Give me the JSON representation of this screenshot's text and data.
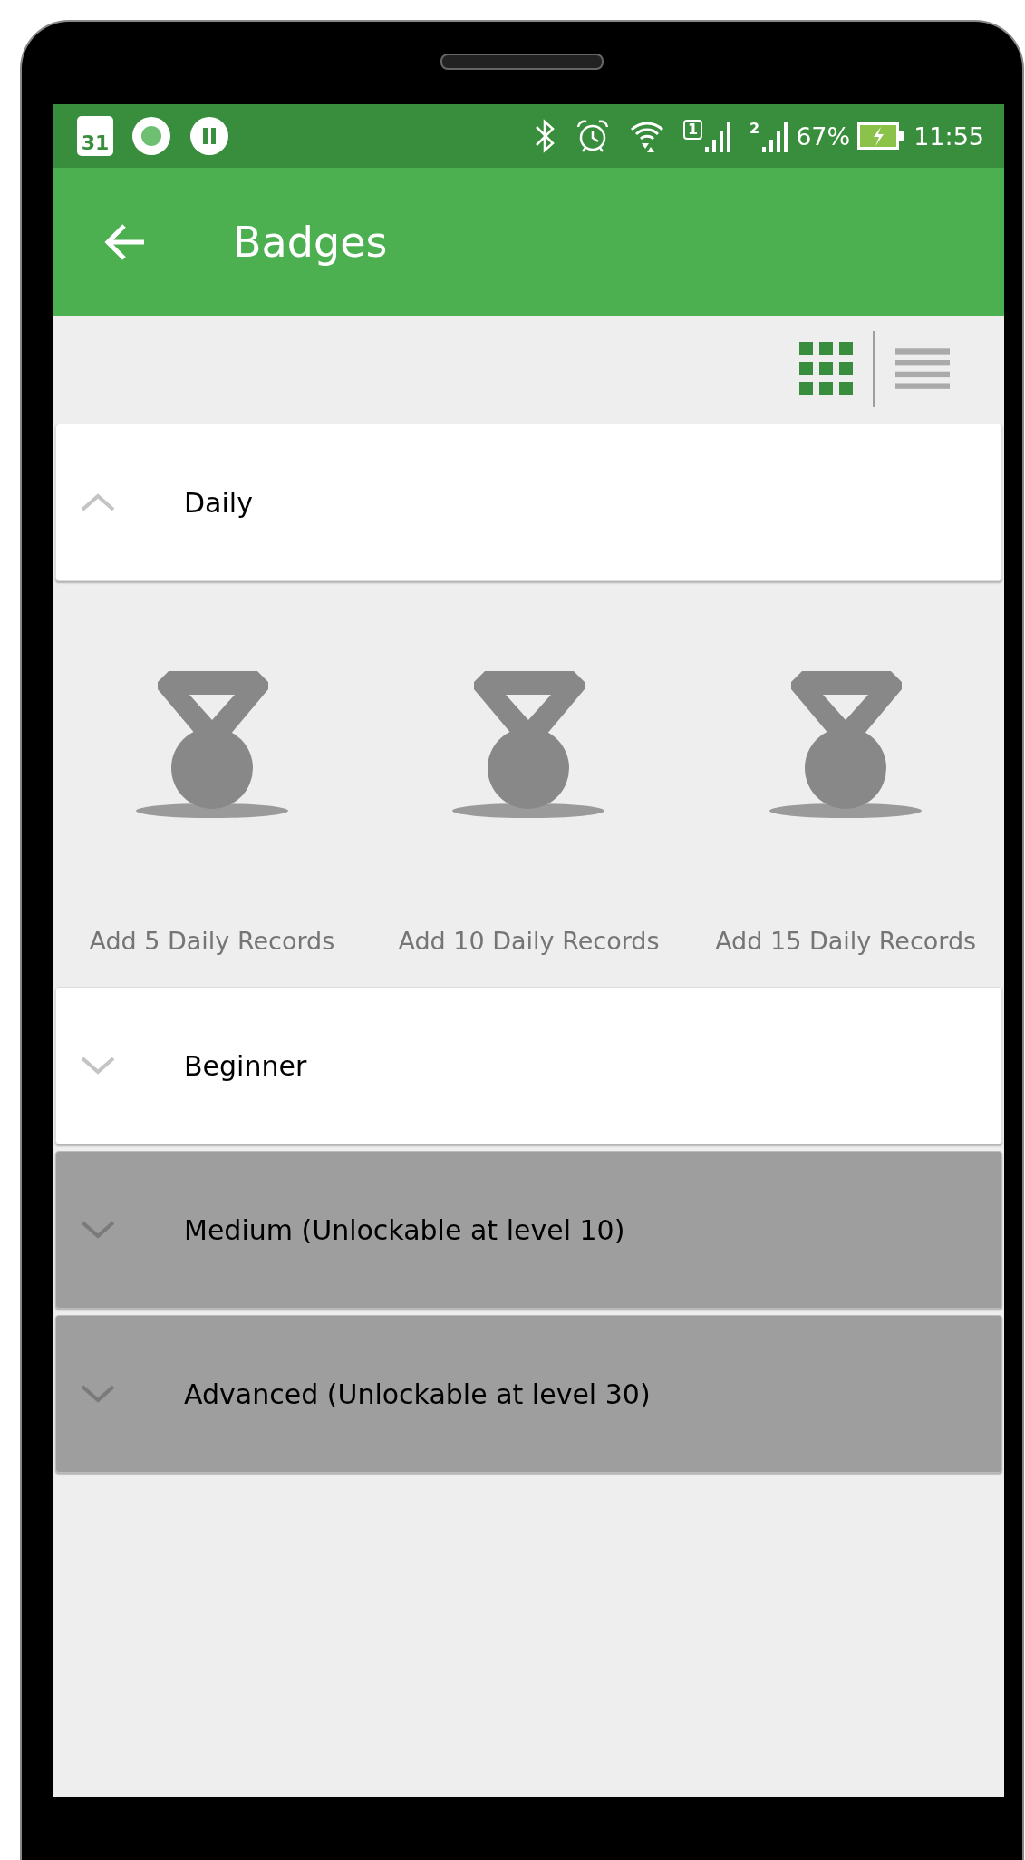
{
  "status_bar": {
    "calendar_day": "31",
    "sim1_label": "1",
    "sim2_label": "2",
    "battery": "67%",
    "time": "11:55"
  },
  "app_bar": {
    "title": "Badges"
  },
  "view_toggle": [
    {
      "kind": "grid",
      "selected": true
    },
    {
      "kind": "list",
      "selected": false
    }
  ],
  "sections": [
    {
      "title": "Daily",
      "expanded": true,
      "locked": false,
      "badges": [
        {
          "label": "Add 5 Daily Records"
        },
        {
          "label": "Add 10 Daily Records"
        },
        {
          "label": "Add 15 Daily Records"
        }
      ]
    },
    {
      "title": "Beginner",
      "expanded": false,
      "locked": false
    },
    {
      "title": "Medium (Unlockable at level 10)",
      "expanded": false,
      "locked": true
    },
    {
      "title": "Advanced (Unlockable at level 30)",
      "expanded": false,
      "locked": true
    }
  ]
}
